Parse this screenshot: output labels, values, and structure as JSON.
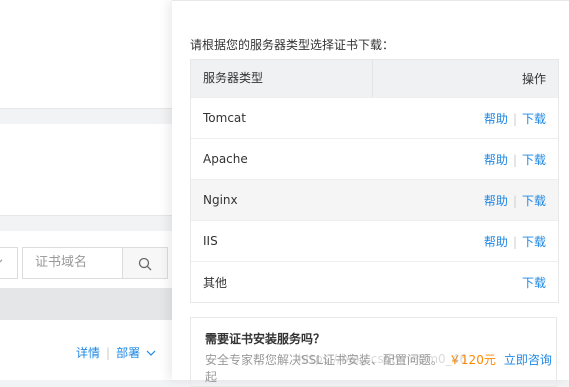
{
  "background": {
    "search_placeholder": "证书域名",
    "row_actions": {
      "detail": "详情",
      "deploy": "部署",
      "sep": "|"
    }
  },
  "panel": {
    "prompt": "请根据您的服务器类型选择证书下载：",
    "table": {
      "col_type": "服务器类型",
      "col_action": "操作",
      "rows": [
        {
          "name": "Tomcat",
          "help": "帮助",
          "sep": "|",
          "download": "下载"
        },
        {
          "name": "Apache",
          "help": "帮助",
          "sep": "|",
          "download": "下载"
        },
        {
          "name": "Nginx",
          "help": "帮助",
          "sep": "|",
          "download": "下载"
        },
        {
          "name": "IIS",
          "help": "帮助",
          "sep": "|",
          "download": "下载"
        },
        {
          "name": "其他",
          "download": "下载"
        }
      ]
    },
    "promo": {
      "title": "需要证书安装服务吗？",
      "desc": "安全专家帮您解决SSL证书安装、配置问题。",
      "price": "￥120元",
      "consult": "立即咨询",
      "desc_tail": "起"
    }
  },
  "watermark": "https://blog.csdn.net/m0_46"
}
